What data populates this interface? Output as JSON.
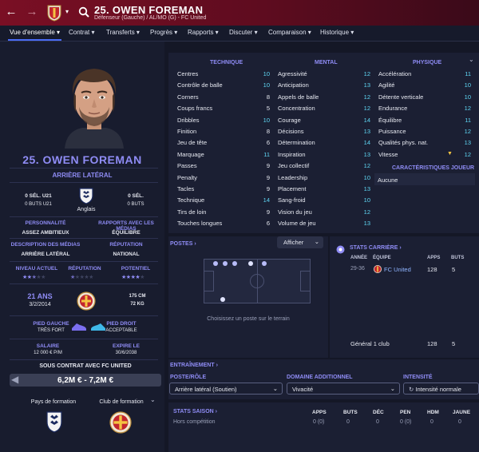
{
  "header": {
    "player_title": "25. OWEN FOREMAN",
    "player_subtitle": "Défenseur (Gauche) / AL/MO (G) - FC United"
  },
  "tabs": [
    {
      "label": "Vue d'ensemble ▾"
    },
    {
      "label": "Contrat ▾"
    },
    {
      "label": "Transferts ▾"
    },
    {
      "label": "Progrès ▾"
    },
    {
      "label": "Rapports ▾"
    },
    {
      "label": "Discuter ▾"
    },
    {
      "label": "Comparaison ▾"
    },
    {
      "label": "Historique ▾"
    }
  ],
  "profile": {
    "name": "25. OWEN FOREMAN",
    "position": "ARRIÈRE LATÉRAL",
    "u21_caps_label": "0 SÉL. U21",
    "u21_goals_label": "0 BUTS U21",
    "senior_caps_label": "0 SÉL.",
    "senior_goals_label": "0 BUTS",
    "nationality": "Anglais",
    "personality_label": "PERSONNALITÉ",
    "personality": "ASSEZ AMBITIEUX",
    "media_relations_label": "RAPPORTS AVEC LES MÉDIAS",
    "media_relations": "ÉQUILIBRE",
    "media_desc_label": "DESCRIPTION DES MÉDIAS",
    "media_desc": "ARRIÈRE LATÉRAL",
    "reputation_label": "RÉPUTATION",
    "reputation": "NATIONAL",
    "current_level_label": "NIVEAU ACTUEL",
    "current_level_stars": 2.5,
    "reputation_stars_label": "RÉPUTATION",
    "reputation_stars": 0.5,
    "potential_label": "POTENTIEL",
    "potential_stars": 4,
    "age": "21 ANS",
    "dob": "3/2/2014",
    "height": "175 CM",
    "weight": "72 KG",
    "left_foot_label": "PIED GAUCHE",
    "left_foot": "TRÈS FORT",
    "right_foot_label": "PIED DROIT",
    "right_foot": "ACCEPTABLE",
    "salary_label": "SALAIRE",
    "salary": "12 000 € P/M",
    "expires_label": "EXPIRE LE",
    "expires": "30/6/2038",
    "contract_label": "SOUS CONTRAT AVEC FC UNITED",
    "value": "6,2M € - 7,2M €",
    "training_country_label": "Pays de formation",
    "training_club_label": "Club de formation"
  },
  "attributes": {
    "technique_header": "TECHNIQUE",
    "mental_header": "MENTAL",
    "physique_header": "PHYSIQUE",
    "technique": [
      {
        "name": "Centres",
        "value": "10"
      },
      {
        "name": "Contrôle de balle",
        "value": "10"
      },
      {
        "name": "Corners",
        "value": "8"
      },
      {
        "name": "Coups francs",
        "value": "5"
      },
      {
        "name": "Dribbles",
        "value": "10"
      },
      {
        "name": "Finition",
        "value": "8"
      },
      {
        "name": "Jeu de tête",
        "value": "6"
      },
      {
        "name": "Marquage",
        "value": "11"
      },
      {
        "name": "Passes",
        "value": "9"
      },
      {
        "name": "Penalty",
        "value": "9"
      },
      {
        "name": "Tacles",
        "value": "9"
      },
      {
        "name": "Technique",
        "value": "14"
      },
      {
        "name": "Tirs de loin",
        "value": "9"
      },
      {
        "name": "Touches longues",
        "value": "6"
      }
    ],
    "mental": [
      {
        "name": "Agressivité",
        "value": "12"
      },
      {
        "name": "Anticipation",
        "value": "13"
      },
      {
        "name": "Appels de balle",
        "value": "12"
      },
      {
        "name": "Concentration",
        "value": "12"
      },
      {
        "name": "Courage",
        "value": "14"
      },
      {
        "name": "Décisions",
        "value": "13"
      },
      {
        "name": "Détermination",
        "value": "14"
      },
      {
        "name": "Inspiration",
        "value": "13"
      },
      {
        "name": "Jeu collectif",
        "value": "12"
      },
      {
        "name": "Leadership",
        "value": "10"
      },
      {
        "name": "Placement",
        "value": "13"
      },
      {
        "name": "Sang-froid",
        "value": "10"
      },
      {
        "name": "Vision du jeu",
        "value": "12"
      },
      {
        "name": "Volume de jeu",
        "value": "13"
      }
    ],
    "physique": [
      {
        "name": "Accélération",
        "value": "11"
      },
      {
        "name": "Agilité",
        "value": "10"
      },
      {
        "name": "Détente verticale",
        "value": "10"
      },
      {
        "name": "Endurance",
        "value": "12"
      },
      {
        "name": "Équilibre",
        "value": "11"
      },
      {
        "name": "Puissance",
        "value": "12"
      },
      {
        "name": "Qualités phys. nat.",
        "value": "13"
      },
      {
        "name": "Vitesse",
        "value": "12"
      }
    ],
    "player_traits_header": "CARACTÉRISTIQUES JOUEUR",
    "player_traits": "Aucune"
  },
  "positions": {
    "title": "POSTES",
    "show_button": "Afficher",
    "hint": "Choisissez un poste sur le terrain"
  },
  "career": {
    "title": "STATS CARRIÈRE",
    "col_year": "ANNÉE",
    "col_team": "ÉQUIPE",
    "col_apps": "APPS",
    "col_goals": "BUTS",
    "row_year": "29-36",
    "row_team": "FC United",
    "row_apps": "128",
    "row_goals": "5",
    "total_label": "Général 1 club",
    "total_apps": "128",
    "total_goals": "5"
  },
  "training": {
    "title": "ENTRAÎNEMENT",
    "role_label": "POSTE/RÔLE",
    "role_value": "Arrière latéral (Soutien)",
    "extra_label": "DOMAINE ADDITIONNEL",
    "extra_value": "Vivacité",
    "intensity_label": "INTENSITÉ",
    "intensity_value": "Intensité normale"
  },
  "season": {
    "title": "STATS SAISON",
    "row_label": "Hors compétition",
    "headers": [
      "APPS",
      "BUTS",
      "DÉC",
      "PEN",
      "HDM",
      "JAUNE"
    ],
    "values": [
      "0 (0)",
      "0",
      "0",
      "0 (0)",
      "0",
      "0"
    ]
  },
  "colors": {
    "header_red": "#7a0f24",
    "accent_purple": "#8f8cf5",
    "accent_cyan": "#5fd7f5",
    "tab_underline": "#4a6cf7"
  }
}
